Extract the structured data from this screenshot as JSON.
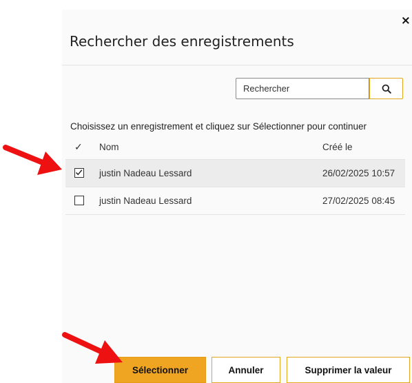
{
  "dialog": {
    "title": "Rechercher des enregistrements",
    "close_label": "×",
    "search": {
      "value": "Rechercher",
      "placeholder": "Rechercher"
    },
    "instruction": "Choisissez un enregistrement et cliquez sur Sélectionner pour continuer",
    "table": {
      "columns": {
        "check": "✓",
        "name": "Nom",
        "date": "Créé le"
      },
      "rows": [
        {
          "name": "justin Nadeau Lessard",
          "date": "26/02/2025 10:57",
          "checked": true
        },
        {
          "name": "justin Nadeau Lessard",
          "date": "27/02/2025 08:45",
          "checked": false
        }
      ]
    },
    "footer": {
      "select_label": "Sélectionner",
      "cancel_label": "Annuler",
      "clear_label": "Supprimer la valeur"
    }
  },
  "annotations": {
    "arrow_color": "#ee1111",
    "arrow_icon": "red-arrow-icon"
  },
  "colors": {
    "accent": "#f0a522",
    "accent_border": "#e2a81d",
    "selected_row": "#ececec"
  }
}
